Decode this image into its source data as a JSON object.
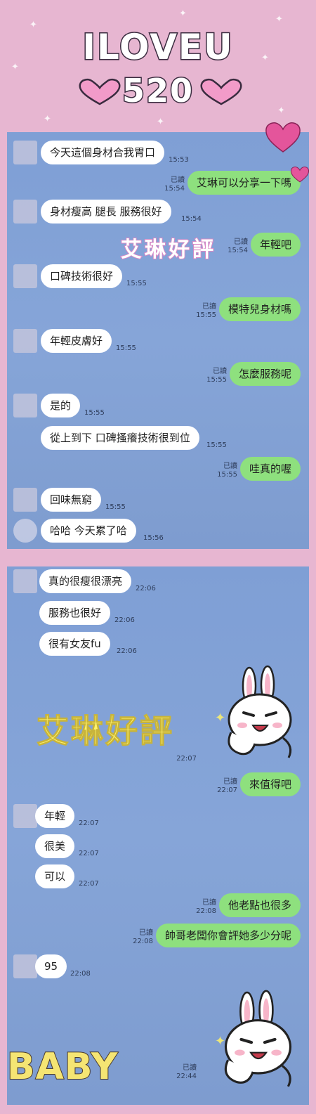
{
  "banner": {
    "line1": "ILOVEU",
    "line2": "520"
  },
  "panel1": {
    "overlay_text": "艾琳好評",
    "messages": [
      {
        "dir": "in",
        "text": "今天這個身材合我胃口",
        "time": "15:53"
      },
      {
        "dir": "out",
        "text": "艾琳可以分享一下嗎",
        "read": "已讀",
        "time": "15:54"
      },
      {
        "dir": "in",
        "text": "身材瘦高 腿長 服務很好",
        "time": "15:54"
      },
      {
        "dir": "out",
        "text": "年輕吧",
        "read": "已讀",
        "time": "15:54"
      },
      {
        "dir": "in",
        "text": "口碑技術很好",
        "time": "15:55"
      },
      {
        "dir": "out",
        "text": "模特兒身材嗎",
        "read": "已讀",
        "time": "15:55"
      },
      {
        "dir": "in",
        "text": "年輕皮膚好",
        "time": "15:55"
      },
      {
        "dir": "out",
        "text": "怎麼服務呢",
        "read": "已讀",
        "time": "15:55"
      },
      {
        "dir": "in",
        "text": "是的",
        "time": "15:55"
      },
      {
        "dir": "in",
        "text": "從上到下 口碑搔癢技術很到位",
        "time": "15:55"
      },
      {
        "dir": "out",
        "text": "哇真的喔",
        "read": "已讀",
        "time": "15:55"
      },
      {
        "dir": "in",
        "text": "回味無窮",
        "time": "15:55"
      },
      {
        "dir": "in",
        "text": "哈哈 今天累了哈",
        "time": "15:56"
      }
    ]
  },
  "panel2": {
    "stamp_text": "艾琳好評",
    "sticker_meta": {
      "read": "已讀",
      "time": "22:07"
    },
    "final_meta": {
      "read": "已讀",
      "time": "22:44"
    },
    "messages": [
      {
        "dir": "in",
        "text": "真的很瘦很漂亮",
        "time": "22:06"
      },
      {
        "dir": "in",
        "text": "服務也很好",
        "time": "22:06"
      },
      {
        "dir": "in",
        "text": "很有女友fu",
        "time": "22:06"
      },
      {
        "dir": "out",
        "text": "來值得吧",
        "read": "已讀",
        "time": "22:07"
      },
      {
        "dir": "in",
        "text": "年輕",
        "time": "22:07"
      },
      {
        "dir": "in",
        "text": "很美",
        "time": "22:07"
      },
      {
        "dir": "in",
        "text": "可以",
        "time": "22:07"
      },
      {
        "dir": "out",
        "text": "他老點也很多",
        "read": "已讀",
        "time": "22:08"
      },
      {
        "dir": "out",
        "text": "帥哥老闆你會評她多少分呢",
        "read": "已讀",
        "time": "22:08"
      },
      {
        "dir": "in",
        "text": "95",
        "time": "22:08"
      }
    ]
  },
  "footer": {
    "baby_text": "BABY"
  },
  "colors": {
    "background": "#e7b6d1",
    "chat_bg": "#86a5d8",
    "outgoing": "#8ee07e",
    "incoming": "#ffffff",
    "heart": "#f29bc9"
  }
}
